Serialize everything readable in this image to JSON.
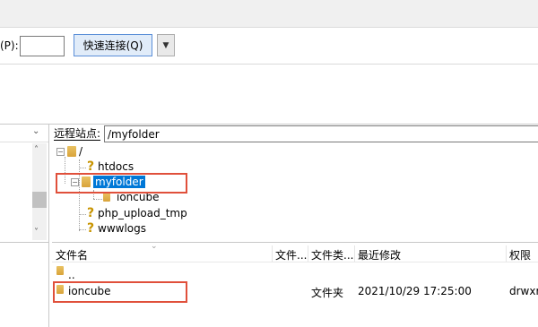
{
  "quickconnect": {
    "port_label": "(P):",
    "port_value": "",
    "connect_label": "快速连接(Q)",
    "dropdown_glyph": "▼"
  },
  "local": {
    "path_dropdown_glyph": "⌄",
    "scroll_up": "˄",
    "scroll_down": "˅"
  },
  "remote": {
    "site_label": "远程站点:",
    "path": "/myfolder",
    "tree": [
      {
        "label": "/",
        "icon": "folder-icon"
      },
      {
        "label": "htdocs",
        "icon": "question-icon"
      },
      {
        "label": "myfolder",
        "icon": "folder-icon",
        "selected": true
      },
      {
        "label": "ioncube",
        "icon": "folder-icon"
      },
      {
        "label": "php_upload_tmp",
        "icon": "question-icon"
      },
      {
        "label": "wwwlogs",
        "icon": "question-icon"
      }
    ],
    "columns": [
      "文件名",
      "文件...",
      "文件类...",
      "最近修改",
      "权限"
    ],
    "files": [
      {
        "name": "..",
        "size": "",
        "type": "",
        "modified": "",
        "perms": ""
      },
      {
        "name": "ioncube",
        "size": "",
        "type": "文件夹",
        "modified": "2021/10/29 17:25:00",
        "perms": "drwxr"
      }
    ]
  },
  "colors": {
    "selection": "#0078d7",
    "highlight_box": "#e0503b",
    "button_bg": "#e1ecf9"
  }
}
